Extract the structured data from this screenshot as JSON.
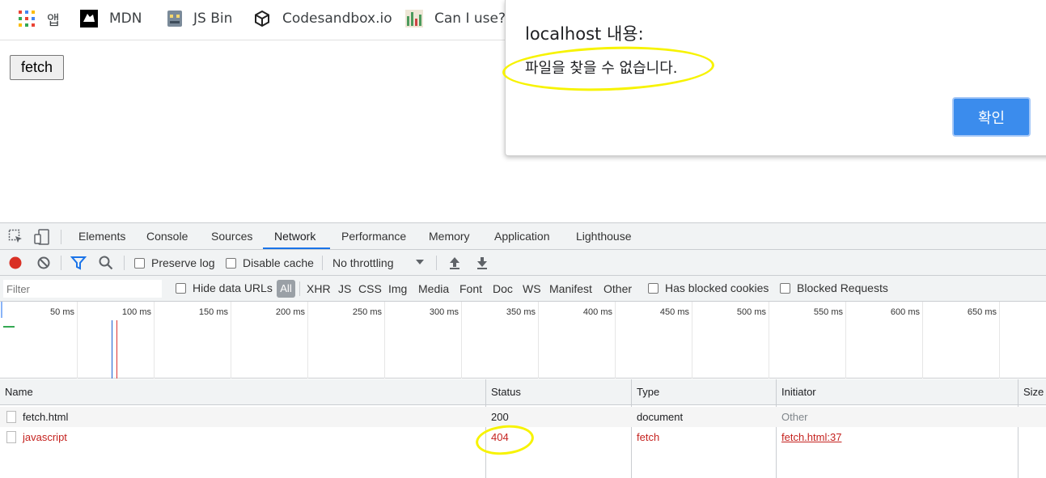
{
  "bookmarks": [
    {
      "label": "앱",
      "icon": "apps-grid-icon"
    },
    {
      "label": "MDN",
      "icon": "mdn-logo-icon"
    },
    {
      "label": "JS Bin",
      "icon": "jsbin-logo-icon"
    },
    {
      "label": "Codesandbox.io",
      "icon": "codesandbox-logo-icon"
    },
    {
      "label": "Can I use?",
      "icon": "caniuse-logo-icon"
    }
  ],
  "page": {
    "fetch_button": "fetch"
  },
  "dialog": {
    "title": "localhost 내용:",
    "message": "파일을 찾을 수 없습니다.",
    "ok_label": "확인",
    "accent": "#3b8ced"
  },
  "devtools": {
    "tabs": [
      "Elements",
      "Console",
      "Sources",
      "Network",
      "Performance",
      "Memory",
      "Application",
      "Lighthouse"
    ],
    "active_tab": "Network",
    "toolbar": {
      "preserve_log": "Preserve log",
      "disable_cache": "Disable cache",
      "throttling": "No throttling"
    },
    "filter": {
      "placeholder": "Filter",
      "hide_data_urls": "Hide data URLs",
      "types": [
        "All",
        "XHR",
        "JS",
        "CSS",
        "Img",
        "Media",
        "Font",
        "Doc",
        "WS",
        "Manifest",
        "Other"
      ],
      "has_blocked_cookies": "Has blocked cookies",
      "blocked_requests": "Blocked Requests"
    },
    "timeline_ticks": [
      "50 ms",
      "100 ms",
      "150 ms",
      "200 ms",
      "250 ms",
      "300 ms",
      "350 ms",
      "400 ms",
      "450 ms",
      "500 ms",
      "550 ms",
      "600 ms",
      "650 ms"
    ],
    "table": {
      "columns": [
        "Name",
        "Status",
        "Type",
        "Initiator",
        "Size"
      ],
      "rows": [
        {
          "name": "fetch.html",
          "status": "200",
          "type": "document",
          "initiator": "Other",
          "error": false
        },
        {
          "name": "javascript",
          "status": "404",
          "type": "fetch",
          "initiator": "fetch.html:37",
          "error": true
        }
      ]
    },
    "colors": {
      "error": "#c5221f",
      "record": "#d93025",
      "active_tab": "#1a73e8"
    }
  }
}
